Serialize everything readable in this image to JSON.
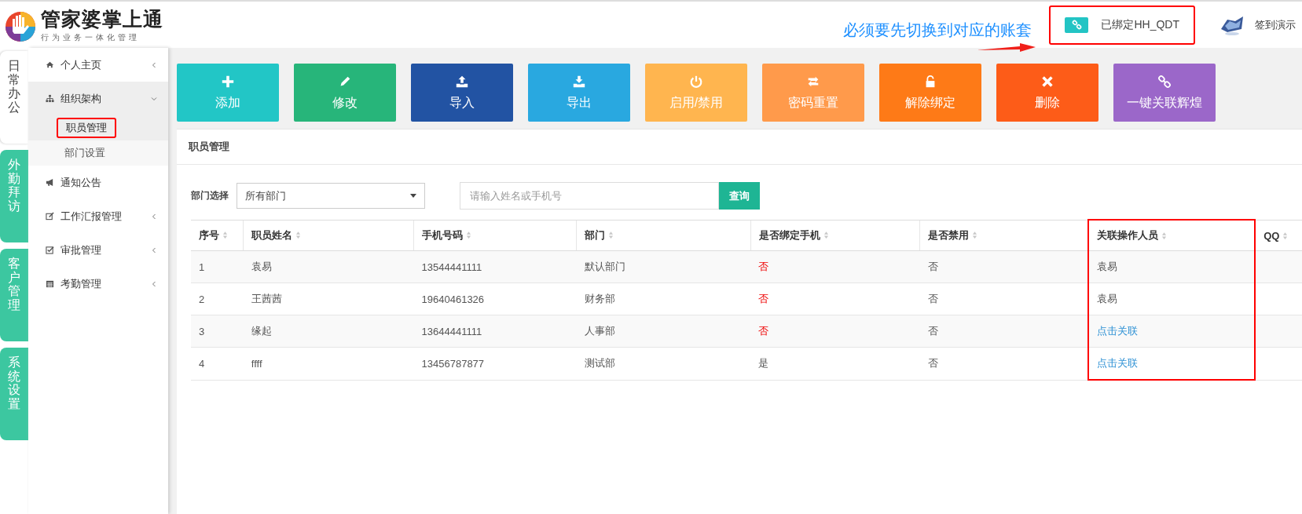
{
  "header": {
    "app_name": "管家婆掌上通",
    "tagline": "行为业务一体化管理",
    "annotation": "必须要先切换到对应的账套",
    "binding": {
      "label": "已绑定HH_QDT",
      "highlighted": true
    },
    "user": "签到演示"
  },
  "side_tabs": [
    {
      "label": "日常办公",
      "selected": true
    },
    {
      "label": "外勤拜访",
      "selected": false
    },
    {
      "label": "客户管理",
      "selected": false
    },
    {
      "label": "系统设置",
      "selected": false
    }
  ],
  "menu": [
    {
      "label": "个人主页",
      "expanded": false,
      "has_children": true
    },
    {
      "label": "组织架构",
      "expanded": true,
      "has_children": true,
      "children": [
        {
          "label": "职员管理",
          "selected": true,
          "highlighted": true
        },
        {
          "label": "部门设置",
          "selected": false,
          "highlighted": false
        }
      ]
    },
    {
      "label": "通知公告",
      "expanded": false,
      "has_children": false
    },
    {
      "label": "工作汇报管理",
      "expanded": false,
      "has_children": true
    },
    {
      "label": "审批管理",
      "expanded": false,
      "has_children": true
    },
    {
      "label": "考勤管理",
      "expanded": false,
      "has_children": true
    }
  ],
  "toolbar": [
    {
      "label": "添加",
      "color": "#22c6c6"
    },
    {
      "label": "修改",
      "color": "#27b57a"
    },
    {
      "label": "导入",
      "color": "#2253a3"
    },
    {
      "label": "导出",
      "color": "#29a8e0"
    },
    {
      "label": "启用/禁用",
      "color": "#ffb54f"
    },
    {
      "label": "密码重置",
      "color": "#ff9a4b"
    },
    {
      "label": "解除绑定",
      "color": "#fe7a17"
    },
    {
      "label": "删除",
      "color": "#fd5c18"
    },
    {
      "label": "一键关联辉煌",
      "color": "#9b67c9"
    }
  ],
  "panel": {
    "title": "职员管理",
    "filter_label": "部门选择",
    "department_select": {
      "value": "所有部门"
    },
    "search": {
      "placeholder": "请输入姓名或手机号"
    },
    "query_button": "查询"
  },
  "table": {
    "columns": [
      {
        "label": "序号",
        "highlighted": false
      },
      {
        "label": "职员姓名",
        "highlighted": false
      },
      {
        "label": "手机号码",
        "highlighted": false
      },
      {
        "label": "部门",
        "highlighted": false
      },
      {
        "label": "是否绑定手机",
        "highlighted": false
      },
      {
        "label": "是否禁用",
        "highlighted": false
      },
      {
        "label": "关联操作人员",
        "highlighted": true
      },
      {
        "label": "QQ",
        "highlighted": false
      }
    ],
    "rows": [
      {
        "cells": [
          {
            "text": "1",
            "kind": "text"
          },
          {
            "text": "袁易",
            "kind": "text"
          },
          {
            "text": "13544441111",
            "kind": "text"
          },
          {
            "text": "默认部门",
            "kind": "text"
          },
          {
            "text": "否",
            "kind": "alert"
          },
          {
            "text": "否",
            "kind": "text"
          },
          {
            "text": "袁易",
            "kind": "text"
          }
        ]
      },
      {
        "cells": [
          {
            "text": "2",
            "kind": "text"
          },
          {
            "text": "王茜茜",
            "kind": "text"
          },
          {
            "text": "19640461326",
            "kind": "text"
          },
          {
            "text": "财务部",
            "kind": "text"
          },
          {
            "text": "否",
            "kind": "alert"
          },
          {
            "text": "否",
            "kind": "text"
          },
          {
            "text": "袁易",
            "kind": "text"
          }
        ]
      },
      {
        "cells": [
          {
            "text": "3",
            "kind": "text"
          },
          {
            "text": "缘起",
            "kind": "text"
          },
          {
            "text": "13644441111",
            "kind": "text"
          },
          {
            "text": "人事部",
            "kind": "text"
          },
          {
            "text": "否",
            "kind": "alert"
          },
          {
            "text": "否",
            "kind": "text"
          },
          {
            "text": "点击关联",
            "kind": "link"
          }
        ]
      },
      {
        "cells": [
          {
            "text": "4",
            "kind": "text"
          },
          {
            "text": "ffff",
            "kind": "text"
          },
          {
            "text": "13456787877",
            "kind": "text"
          },
          {
            "text": "测试部",
            "kind": "text"
          },
          {
            "text": "是",
            "kind": "text"
          },
          {
            "text": "否",
            "kind": "text"
          },
          {
            "text": "点击关联",
            "kind": "link"
          }
        ]
      }
    ]
  }
}
